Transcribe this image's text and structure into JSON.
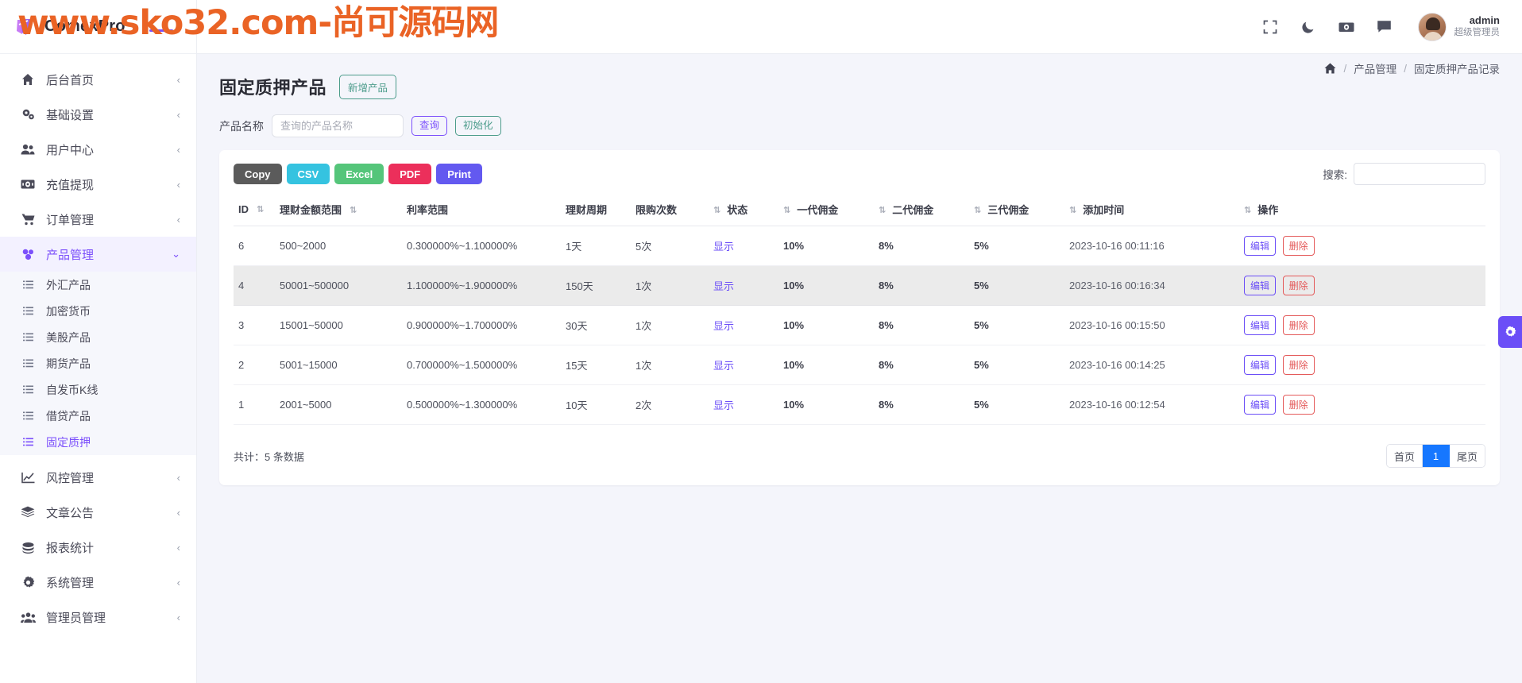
{
  "watermark": "www.sko32.com-尚可源码网",
  "brand": {
    "name": "ComexPro"
  },
  "sidebar": {
    "items": [
      {
        "label": "后台首页",
        "icon": "home-icon",
        "caret": "‹"
      },
      {
        "label": "基础设置",
        "icon": "cogs-icon",
        "caret": "‹"
      },
      {
        "label": "用户中心",
        "icon": "users-icon",
        "caret": "‹"
      },
      {
        "label": "充值提现",
        "icon": "money-icon",
        "caret": "‹"
      },
      {
        "label": "订单管理",
        "icon": "cart-icon",
        "caret": "‹"
      },
      {
        "label": "产品管理",
        "icon": "cubes-icon",
        "caret": "⌄",
        "active": true
      }
    ],
    "submenu": [
      {
        "label": "外汇产品"
      },
      {
        "label": "加密货币"
      },
      {
        "label": "美股产品"
      },
      {
        "label": "期货产品"
      },
      {
        "label": "自发币K线"
      },
      {
        "label": "借贷产品"
      },
      {
        "label": "固定质押",
        "active": true
      }
    ],
    "items_after": [
      {
        "label": "风控管理",
        "icon": "chart-line-icon",
        "caret": "‹"
      },
      {
        "label": "文章公告",
        "icon": "layers-icon",
        "caret": "‹"
      },
      {
        "label": "报表统计",
        "icon": "coins-icon",
        "caret": "‹"
      },
      {
        "label": "系统管理",
        "icon": "gear-icon",
        "caret": "‹"
      },
      {
        "label": "管理员管理",
        "icon": "user-group-icon",
        "caret": "‹"
      }
    ]
  },
  "topbar": {
    "icons": [
      "fullscreen-icon",
      "moon-icon",
      "cash-icon",
      "chat-icon"
    ],
    "user": {
      "name": "admin",
      "role": "超级管理员"
    }
  },
  "page": {
    "title": "固定质押产品",
    "add_button": "新增产品",
    "breadcrumb": {
      "home_icon": "home-icon",
      "sep": "/",
      "parent": "产品管理",
      "current": "固定质押产品记录"
    }
  },
  "filter": {
    "label": "产品名称",
    "placeholder": "查询的产品名称",
    "value": "",
    "search_button": "查询",
    "reset_button": "初始化"
  },
  "table_toolbar": {
    "export": [
      {
        "label": "Copy",
        "color": "#5b5b5b"
      },
      {
        "label": "CSV",
        "color": "#35c3e0"
      },
      {
        "label": "Excel",
        "color": "#55c57a"
      },
      {
        "label": "PDF",
        "color": "#ec2f5b"
      },
      {
        "label": "Print",
        "color": "#6359f0"
      }
    ],
    "search_label": "搜索:",
    "search_value": "",
    "search_placeholder": ""
  },
  "table": {
    "columns": [
      {
        "label": "ID",
        "sortable": true
      },
      {
        "label": "理财金额范围",
        "sortable": true
      },
      {
        "label": "利率范围",
        "sortable": false
      },
      {
        "label": "理财周期",
        "sortable": false
      },
      {
        "label": "限购次数",
        "sortable": false
      },
      {
        "label": "状态",
        "sortable": true
      },
      {
        "label": "一代佣金",
        "sortable": true
      },
      {
        "label": "二代佣金",
        "sortable": true
      },
      {
        "label": "三代佣金",
        "sortable": true
      },
      {
        "label": "添加时间",
        "sortable": true
      },
      {
        "label": "操作",
        "sortable": true
      }
    ],
    "rows": [
      {
        "id": "6",
        "amount_range": "500~2000",
        "rate_range": "0.300000%~1.100000%",
        "period": "1天",
        "limit": "5次",
        "status": "显示",
        "c1": "10%",
        "c2": "8%",
        "c3": "5%",
        "created": "2023-10-16 00:11:16",
        "edit": "编辑",
        "delete": "删除"
      },
      {
        "id": "4",
        "amount_range": "50001~500000",
        "rate_range": "1.100000%~1.900000%",
        "period": "150天",
        "limit": "1次",
        "status": "显示",
        "c1": "10%",
        "c2": "8%",
        "c3": "5%",
        "created": "2023-10-16 00:16:34",
        "edit": "编辑",
        "delete": "删除"
      },
      {
        "id": "3",
        "amount_range": "15001~50000",
        "rate_range": "0.900000%~1.700000%",
        "period": "30天",
        "limit": "1次",
        "status": "显示",
        "c1": "10%",
        "c2": "8%",
        "c3": "5%",
        "created": "2023-10-16 00:15:50",
        "edit": "编辑",
        "delete": "删除"
      },
      {
        "id": "2",
        "amount_range": "5001~15000",
        "rate_range": "0.700000%~1.500000%",
        "period": "15天",
        "limit": "1次",
        "status": "显示",
        "c1": "10%",
        "c2": "8%",
        "c3": "5%",
        "created": "2023-10-16 00:14:25",
        "edit": "编辑",
        "delete": "删除"
      },
      {
        "id": "1",
        "amount_range": "2001~5000",
        "rate_range": "0.500000%~1.300000%",
        "period": "10天",
        "limit": "2次",
        "status": "显示",
        "c1": "10%",
        "c2": "8%",
        "c3": "5%",
        "created": "2023-10-16 00:12:54",
        "edit": "编辑",
        "delete": "删除"
      }
    ]
  },
  "footer": {
    "total": "共计：5 条数据",
    "pager": {
      "first": "首页",
      "current": "1",
      "last": "尾页"
    }
  },
  "colors": {
    "accent": "#7b4ffb",
    "watermark": "#ea6325",
    "pager_active": "#1677ff",
    "danger": "#e45a5a"
  }
}
